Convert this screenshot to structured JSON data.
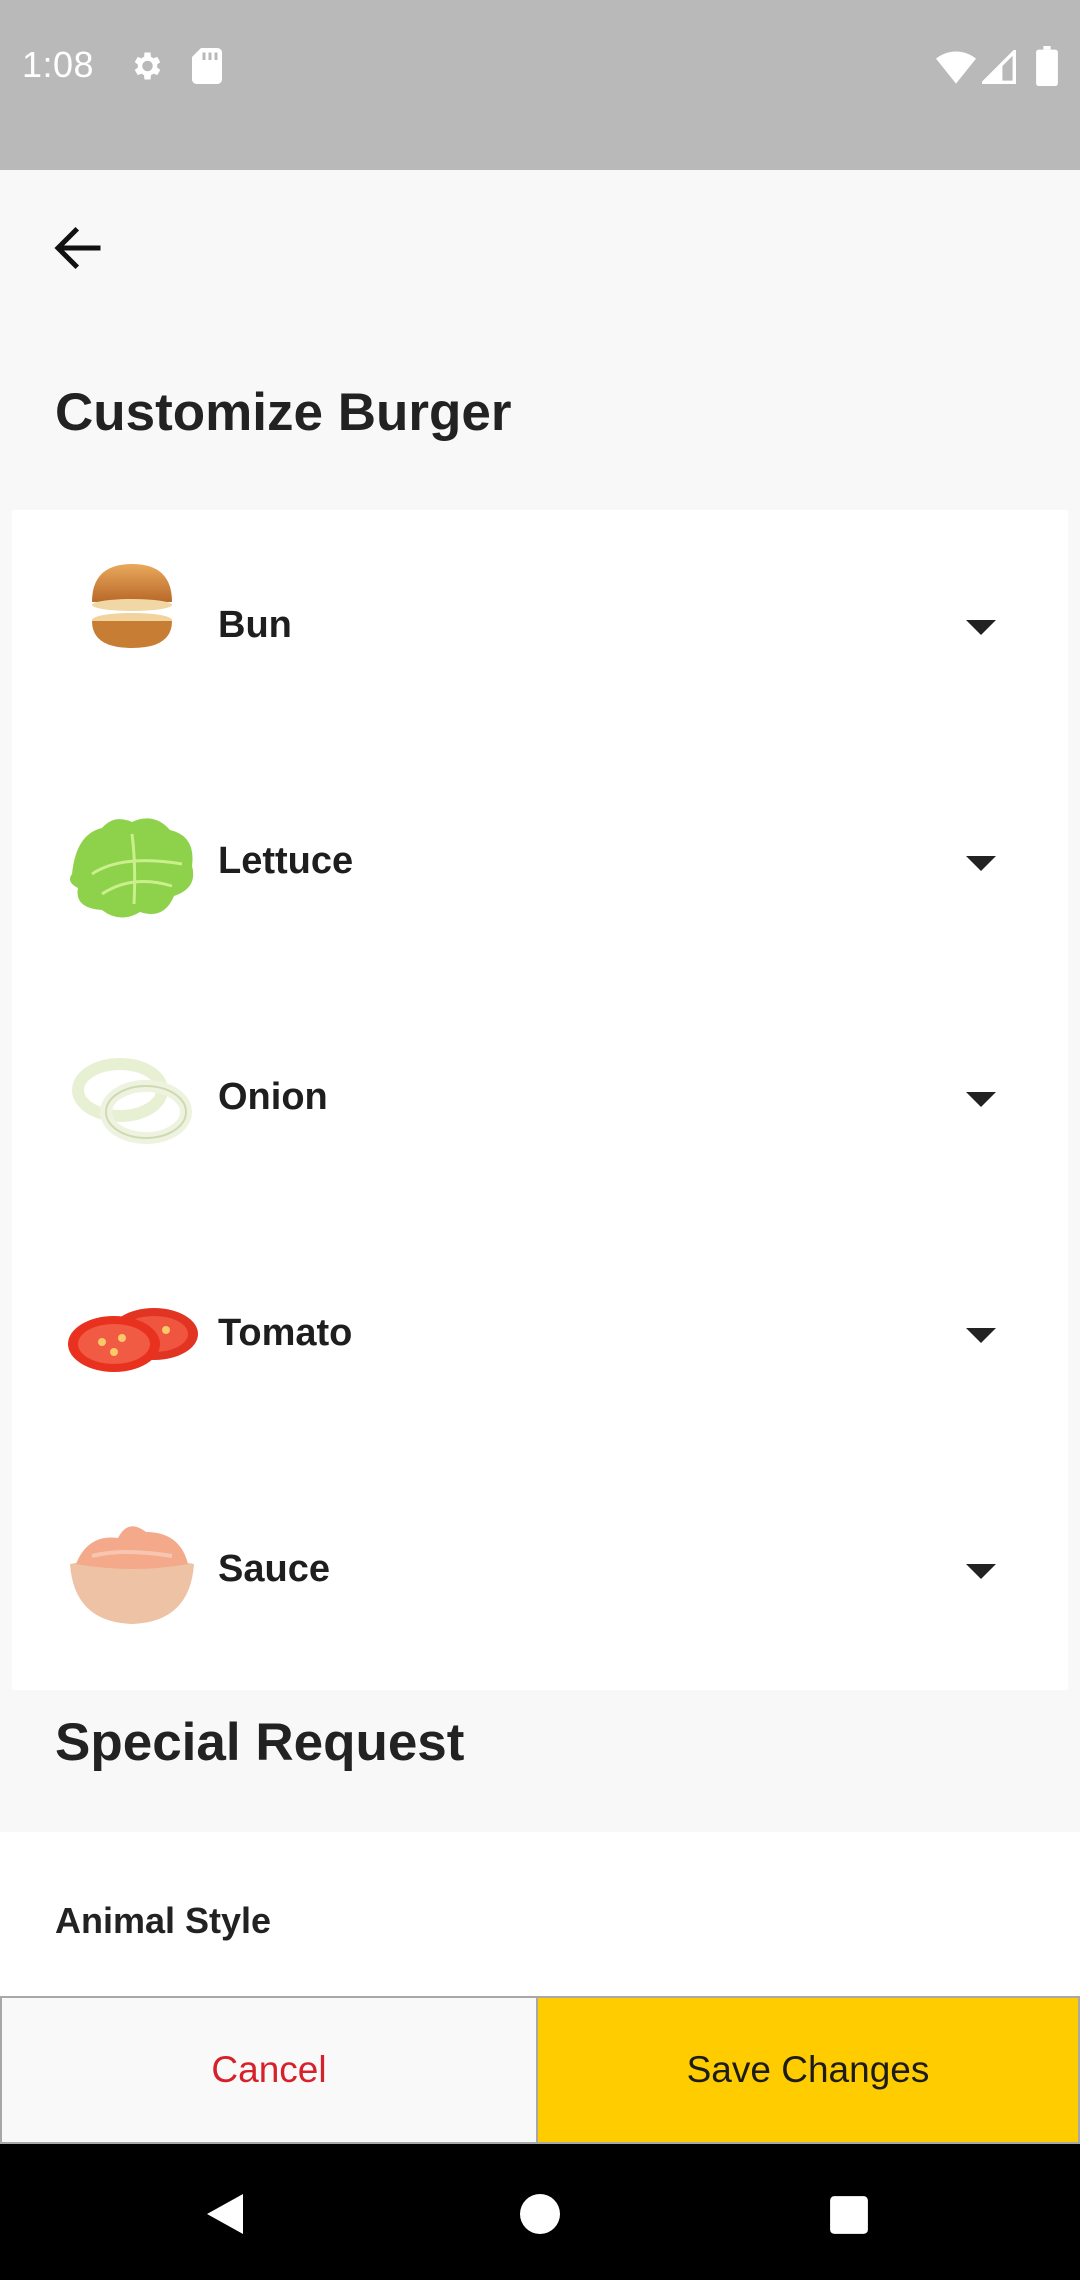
{
  "status_bar": {
    "time": "1:08",
    "icons": [
      "gear-icon",
      "sd-card-icon",
      "wifi-icon",
      "cell-signal-icon",
      "battery-icon"
    ]
  },
  "header": {
    "back_icon": "arrow-left-icon",
    "title": "Customize Burger"
  },
  "ingredients": [
    {
      "label": "Bun",
      "image": "bun-image"
    },
    {
      "label": "Lettuce",
      "image": "lettuce-image"
    },
    {
      "label": "Onion",
      "image": "onion-image"
    },
    {
      "label": "Tomato",
      "image": "tomato-image"
    },
    {
      "label": "Sauce",
      "image": "sauce-image"
    }
  ],
  "special_request": {
    "title": "Special Request",
    "option": "Animal Style"
  },
  "actions": {
    "cancel_label": "Cancel",
    "save_label": "Save Changes"
  },
  "colors": {
    "accent": "#ffcc00",
    "cancel_text": "#d6212b",
    "status_bar": "#b9b9b9"
  },
  "nav_bar": {
    "icons": [
      "nav-back-icon",
      "nav-home-icon",
      "nav-recents-icon"
    ]
  }
}
